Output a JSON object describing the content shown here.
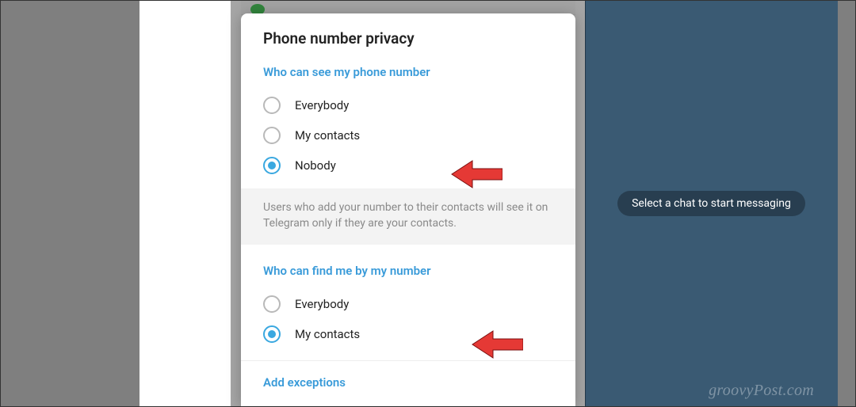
{
  "chatArea": {
    "emptyMessage": "Select a chat to start messaging"
  },
  "watermark": "groovyPost.com",
  "modal": {
    "title": "Phone number privacy",
    "see": {
      "header": "Who can see my phone number",
      "options": {
        "everybody": "Everybody",
        "myContacts": "My contacts",
        "nobody": "Nobody"
      },
      "selected": "nobody",
      "hint": "Users who add your number to their contacts will see it on Telegram only if they are your contacts."
    },
    "find": {
      "header": "Who can find me by my number",
      "options": {
        "everybody": "Everybody",
        "myContacts": "My contacts"
      },
      "selected": "myContacts"
    },
    "addExceptions": "Add exceptions"
  }
}
